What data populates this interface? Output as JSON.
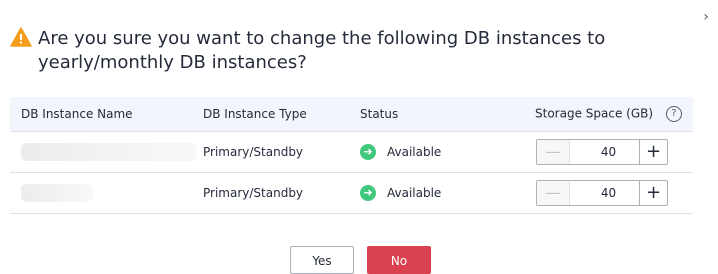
{
  "dialog": {
    "title": "Are you sure you want to change the following DB instances to yearly/monthly DB instances?",
    "close_glyph": "›"
  },
  "table": {
    "columns": [
      "DB Instance Name",
      "DB Instance Type",
      "Status",
      "Storage Space (GB)"
    ],
    "help_glyph": "?",
    "rows": [
      {
        "name": "",
        "type": "Primary/Standby",
        "status": "Available",
        "storage": "40"
      },
      {
        "name": "",
        "type": "Primary/Standby",
        "status": "Available",
        "storage": "40"
      }
    ]
  },
  "icons": {
    "warning": "warning-icon",
    "status": "arrow-right-circle-icon",
    "help": "help-circle-icon",
    "minus": "minus-icon",
    "plus": "plus-icon"
  },
  "stepper": {
    "minus_glyph": "—",
    "plus_glyph": "+"
  },
  "status_glyph": "➜",
  "buttons": {
    "yes": "Yes",
    "no": "No"
  },
  "colors": {
    "warning": "#f49e1b",
    "status_green": "#40c97c",
    "header_bg": "#f2f5fc",
    "no_button": "#d9424e"
  }
}
